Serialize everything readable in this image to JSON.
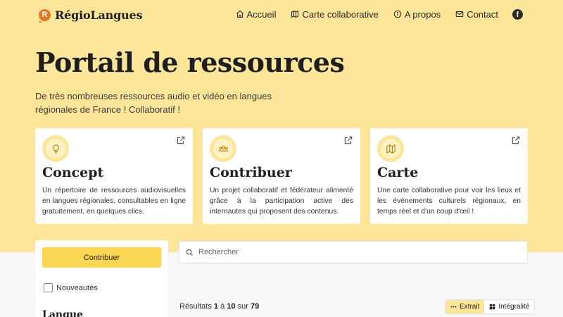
{
  "brand": {
    "logo_letter": "R",
    "name": "RégioLangues"
  },
  "nav": {
    "items": [
      {
        "label": "Accueil",
        "icon": "home-icon"
      },
      {
        "label": "Carte collaborative",
        "icon": "map-icon"
      },
      {
        "label": "A propos",
        "icon": "info-icon"
      },
      {
        "label": "Contact",
        "icon": "mail-icon"
      }
    ],
    "social": {
      "icon": "facebook-icon",
      "glyph": "f"
    }
  },
  "hero": {
    "title": "Portail de ressources",
    "subtitle": "De très nombreuses ressources audio et vidéo en langues régionales de France ! Collaboratif !"
  },
  "cards": [
    {
      "icon": "lightbulb-icon",
      "title": "Concept",
      "text": "Un répertoire de ressources audiovisuelles en langues régionales, consultables en ligne gratuitement, en quelques clics."
    },
    {
      "icon": "users-icon",
      "title": "Contribuer",
      "text": "Un projet collaboratif et fédérateur alimenté grâce à la participation active des internautes qui proposent des contenus."
    },
    {
      "icon": "map-icon",
      "title": "Carte",
      "text": "Une carte collaborative pour voir les lieux et les événements culturels régionaux, en temps réel et d'un coup d'œil !"
    }
  ],
  "sidebar": {
    "contribute_label": "Contribuer",
    "new_label": "Nouveautés",
    "section_title": "Langue"
  },
  "search": {
    "placeholder": "Rechercher"
  },
  "results": {
    "prefix": "Résultats",
    "from": "1",
    "sep1": "à",
    "to": "10",
    "sep2": "sur",
    "total": "79"
  },
  "view_toggle": {
    "excerpt_label": "Extrait",
    "full_label": "Intégralité",
    "active": "excerpt"
  },
  "colors": {
    "hero_bg": "#fde69a",
    "accent": "#fdd653",
    "logo": "#e07a1c"
  }
}
